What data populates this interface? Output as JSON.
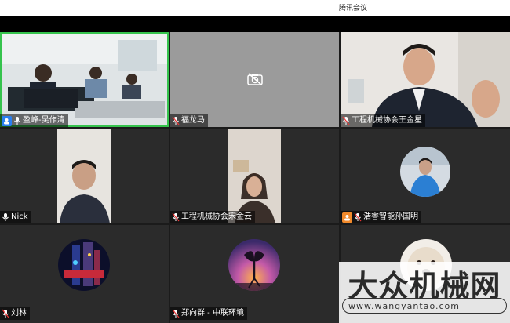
{
  "window": {
    "title": "腾讯会议"
  },
  "participants": [
    {
      "name": "盈峰-吴作清"
    },
    {
      "name": "福龙马"
    },
    {
      "name": "工程机械协会王金星"
    },
    {
      "name": "Nick"
    },
    {
      "name": "工程机械协会宋金云"
    },
    {
      "name": "浩睿智能孙国明"
    },
    {
      "name": "刘林"
    },
    {
      "name": "郑向群 - 中联环境"
    },
    {
      "name": ""
    }
  ],
  "watermark": {
    "brand": "大众机械网",
    "url": "www.wangyantao.com"
  },
  "colors": {
    "active_border": "#35c34d",
    "host_badge": "#2a7ff0",
    "tile_bg": "#2b2b2b"
  }
}
